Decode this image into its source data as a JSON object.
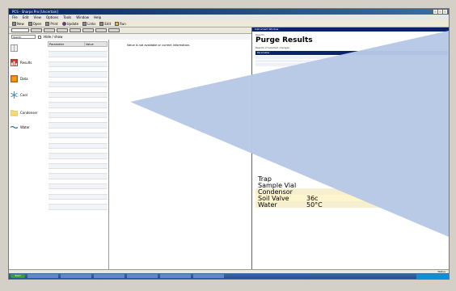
{
  "window": {
    "title": "PCS - Sharps Pro [Uncertain]"
  },
  "menu": [
    "File",
    "Edit",
    "View",
    "Options",
    "Tools",
    "Window",
    "Help"
  ],
  "toolbar": {
    "items": [
      "New",
      "Open",
      "Print",
      "Unknown",
      "Links",
      "Edit",
      "Run"
    ],
    "ok_label": "Update"
  },
  "filter": {
    "search_placeholder": "Search",
    "checkbox_label": "Hide / show"
  },
  "sidebar": {
    "items": [
      {
        "label": "",
        "icon": "grid-icon"
      },
      {
        "label": "Results",
        "icon": "chart-icon"
      },
      {
        "label": "Data",
        "icon": "data-icon"
      },
      {
        "label": "Cool",
        "icon": "snowflake-icon"
      },
      {
        "label": "Condenser",
        "icon": "folder-icon"
      },
      {
        "label": "Water",
        "icon": "water-icon"
      }
    ]
  },
  "params": {
    "headers": [
      "Parameter",
      "Value"
    ],
    "rows": [
      "",
      "",
      "",
      "",
      "",
      "",
      "",
      "",
      "",
      "",
      "",
      "",
      "",
      "",
      "",
      "",
      "",
      "",
      "",
      "",
      "",
      "",
      "",
      "",
      "",
      "",
      "",
      "",
      "",
      "",
      "",
      ""
    ]
  },
  "detail": {
    "message": "Value is not available or current information."
  },
  "right_panel": {
    "titlebar": "Instrument Window",
    "subtitle": "Results",
    "heading": "Purge Results",
    "description": "Results of selected changes",
    "list_header": "Parameter",
    "results": [
      {
        "label": "Trap",
        "value": ""
      },
      {
        "label": "Sample Vial",
        "value": ""
      },
      {
        "label": "Condensor",
        "value": ""
      },
      {
        "label": "Soil Valve",
        "value": "36c"
      },
      {
        "label": "Water",
        "value": "50°C"
      }
    ]
  },
  "status": {
    "text": "Status"
  },
  "taskbar": {
    "start": "Start",
    "tasks": [
      "",
      "",
      "",
      "",
      "",
      "",
      ""
    ]
  },
  "colors": {
    "overlay": "#b7c8e6",
    "accent": "#0a246a"
  }
}
